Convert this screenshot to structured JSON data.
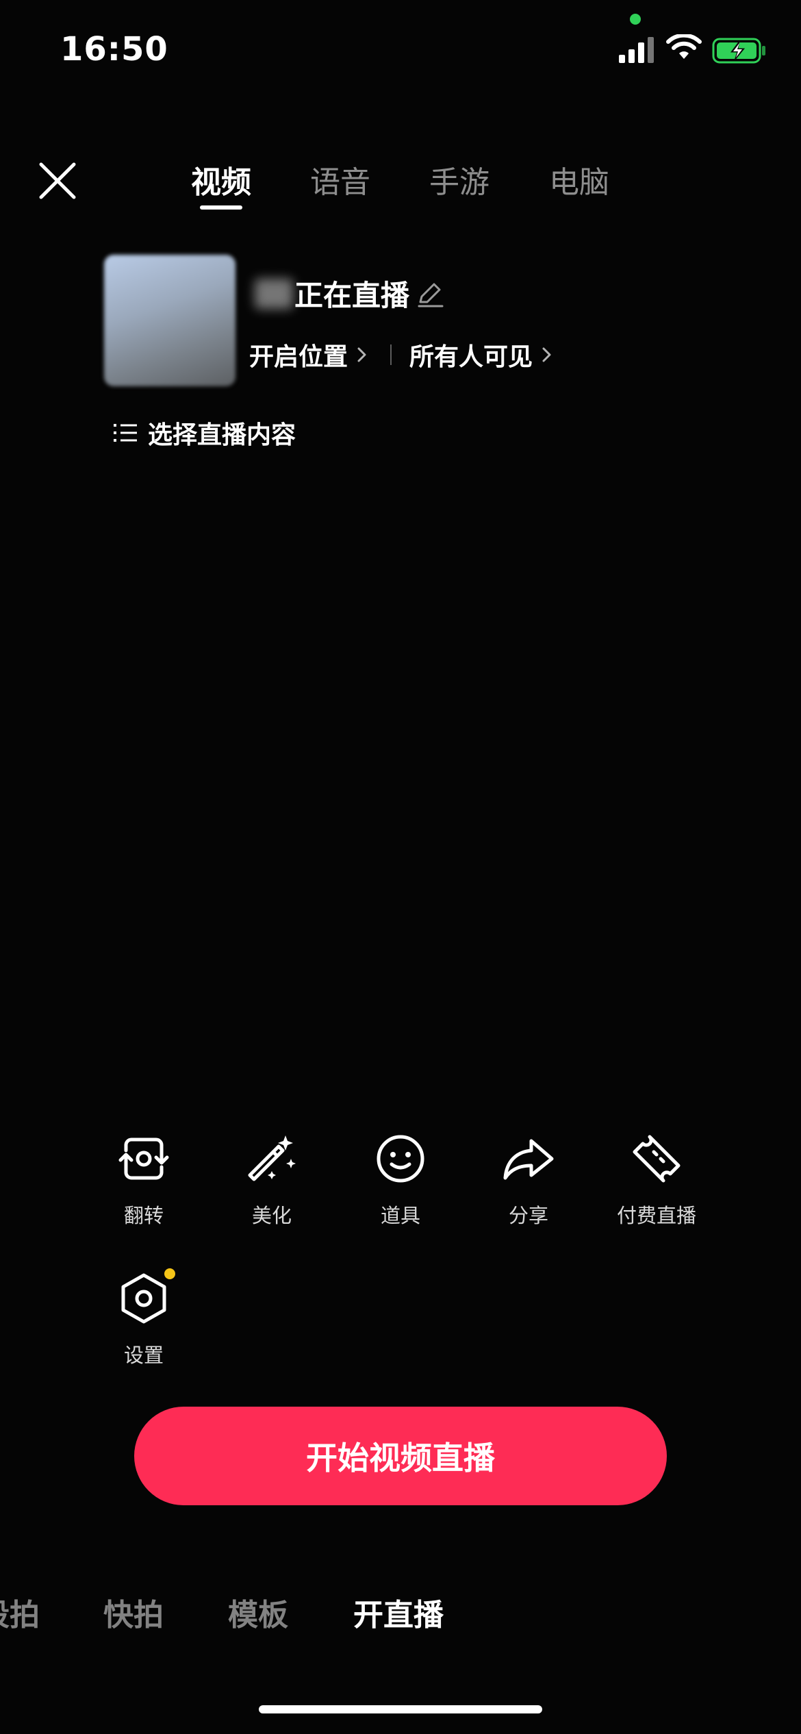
{
  "status_bar": {
    "time": "16:50",
    "icons": [
      "camera-active-dot",
      "signal-icon",
      "wifi-icon",
      "battery-charging-icon"
    ]
  },
  "top_tabs": {
    "items": [
      {
        "label": "视频",
        "active": true
      },
      {
        "label": "语音",
        "active": false
      },
      {
        "label": "手游",
        "active": false
      },
      {
        "label": "电脑",
        "active": false
      }
    ]
  },
  "room": {
    "title": "正在直播",
    "location_label": "开启位置",
    "visibility_label": "所有人可见",
    "content_label": "选择直播内容"
  },
  "tools": [
    {
      "label": "翻转",
      "icon": "flip-camera-icon"
    },
    {
      "label": "美化",
      "icon": "magic-wand-icon"
    },
    {
      "label": "道具",
      "icon": "smiley-face-icon"
    },
    {
      "label": "分享",
      "icon": "share-arrow-icon"
    },
    {
      "label": "付费直播",
      "icon": "ticket-icon"
    },
    {
      "label": "设置",
      "icon": "settings-hex-icon"
    }
  ],
  "start_button": {
    "label": "开始视频直播"
  },
  "bottom_modes": [
    {
      "label": "段拍",
      "active": false
    },
    {
      "label": "快拍",
      "active": false
    },
    {
      "label": "模板",
      "active": false
    },
    {
      "label": "开直播",
      "active": true
    }
  ],
  "colors": {
    "background": "#050505",
    "accent": "#fe2c55",
    "badge": "#f5c518",
    "status_green": "#30d158"
  }
}
